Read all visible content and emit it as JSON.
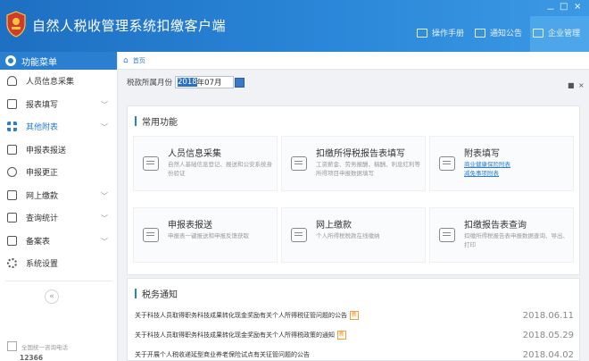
{
  "app": {
    "title": "自然人税收管理系统扣缴客户端",
    "header_links": [
      "操作手册",
      "通知公告",
      "企业管理"
    ],
    "window_controls": [
      "－",
      "□",
      "×"
    ]
  },
  "sidebar": {
    "header": "功能菜单",
    "items": [
      {
        "label": "人员信息采集",
        "icon": "user-icon",
        "chevron": ""
      },
      {
        "label": "报表填写",
        "icon": "edit-icon",
        "chevron": "﹀"
      },
      {
        "label": "其他附表",
        "icon": "grid-icon",
        "chevron": "﹀"
      },
      {
        "label": "申报表报送",
        "icon": "send-doc-icon",
        "chevron": ""
      },
      {
        "label": "申报更正",
        "icon": "search-icon",
        "chevron": ""
      },
      {
        "label": "网上缴款",
        "icon": "wallet-icon",
        "chevron": "﹀"
      },
      {
        "label": "查询统计",
        "icon": "query-icon",
        "chevron": "﹀"
      },
      {
        "label": "备案表",
        "icon": "folder-icon",
        "chevron": "﹀"
      },
      {
        "label": "系统设置",
        "icon": "gear-icon",
        "chevron": ""
      }
    ],
    "active_index": 2,
    "collapse_label": "«",
    "hotline_label": "全国统一咨询电话",
    "hotline_number": "12366"
  },
  "breadcrumb": {
    "home_icon": "⌂",
    "label": "首页",
    "controls": [
      "■",
      "×"
    ]
  },
  "filter": {
    "label": "税款所属月份",
    "year_selected": "2018",
    "month_rest": "年07月"
  },
  "common_functions": {
    "title": "常用功能",
    "cards": [
      {
        "title": "人员信息采集",
        "desc": "自然人基础信息登记、报送和公安系统身份验证",
        "links": []
      },
      {
        "title": "扣缴所得税报告表填写",
        "desc": "工资薪金、劳务报酬、稿酬、利息红利等所得项目申报数据填写",
        "links": []
      },
      {
        "title": "附表填写",
        "desc": "",
        "links": [
          "商业健康保险附表",
          "减免事项附表"
        ]
      },
      {
        "title": "申报表报送",
        "desc": "申报表一键报送和申报反馈获取",
        "links": []
      },
      {
        "title": "网上缴款",
        "desc": "个人所得税税款在线缴纳",
        "links": []
      },
      {
        "title": "扣缴报告表查询",
        "desc": "扣缴所得税报告表申报数据查询、导出、打印",
        "links": []
      }
    ]
  },
  "tax_notices": {
    "title": "税务通知",
    "new_tag": "新",
    "items": [
      {
        "text": "关于科技人员取得职务科技成果转化现金奖励有关个人所得税征管问题的公告",
        "date": "2018.06.11",
        "is_new": true
      },
      {
        "text": "关于科技人员取得职务科技成果转化现金奖励有关个人所得税政策的通知",
        "date": "2018.05.29",
        "is_new": true
      },
      {
        "text": "关于开展个人税收递延型商业养老保险试点有关征管问题的公告",
        "date": "2018.04.02",
        "is_new": false
      }
    ]
  },
  "colors": {
    "header_blue": "#1e6fc2",
    "accent": "#2a7fd0",
    "new_tag": "#e98a1a"
  }
}
